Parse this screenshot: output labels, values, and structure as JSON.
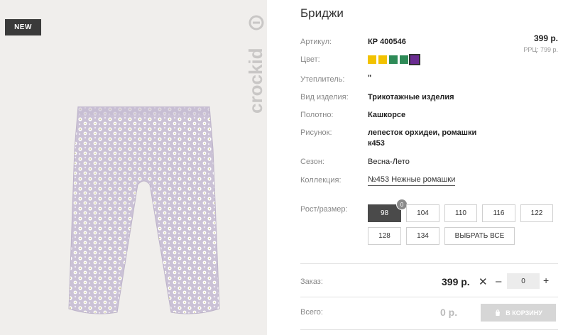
{
  "product": {
    "badge": "NEW",
    "brand": "crockid",
    "title": "Бриджи"
  },
  "price": {
    "current": "399 р.",
    "rrp": "РРЦ: 799 р."
  },
  "details": {
    "article": {
      "label": "Артикул:",
      "value": "КР 400546"
    },
    "color": {
      "label": "Цвет:"
    },
    "insulation": {
      "label": "Утеплитель:",
      "value": "\""
    },
    "item_type": {
      "label": "Вид изделия:",
      "value": "Трикотажные изделия"
    },
    "fabric": {
      "label": "Полотно:",
      "value": "Кашкорсе"
    },
    "pattern": {
      "label": "Рисунок:",
      "value_line1": "лепесток орхидеи, ромашки",
      "value_line2": "к453"
    },
    "season": {
      "label": "Сезон:",
      "value": "Весна-Лето"
    },
    "collection": {
      "label": "Коллекция:",
      "value": "№453 Нежные ромашки"
    }
  },
  "color_swatches": [
    {
      "color": "#f2c200",
      "active": false
    },
    {
      "color": "#f2c200",
      "active": false
    },
    {
      "color": "#2e8b57",
      "active": false
    },
    {
      "color": "#2e8b57",
      "active": false
    },
    {
      "color": "#6a2c91",
      "active": true
    }
  ],
  "sizes": {
    "label": "Рост/размер:",
    "options": [
      "98",
      "104",
      "110",
      "116",
      "122",
      "128",
      "134"
    ],
    "selected": "98",
    "selected_count": "0",
    "select_all": "ВЫБРАТЬ ВСЕ"
  },
  "order": {
    "label": "Заказ:",
    "price": "399 р.",
    "times": "✕",
    "minus": "–",
    "quantity": "0",
    "plus": "+"
  },
  "total": {
    "label": "Всего:",
    "value": "0 р.",
    "cart_button": "В КОРЗИНУ"
  },
  "icons": [
    "cart-icon",
    "close-icon",
    "logo-icon"
  ]
}
